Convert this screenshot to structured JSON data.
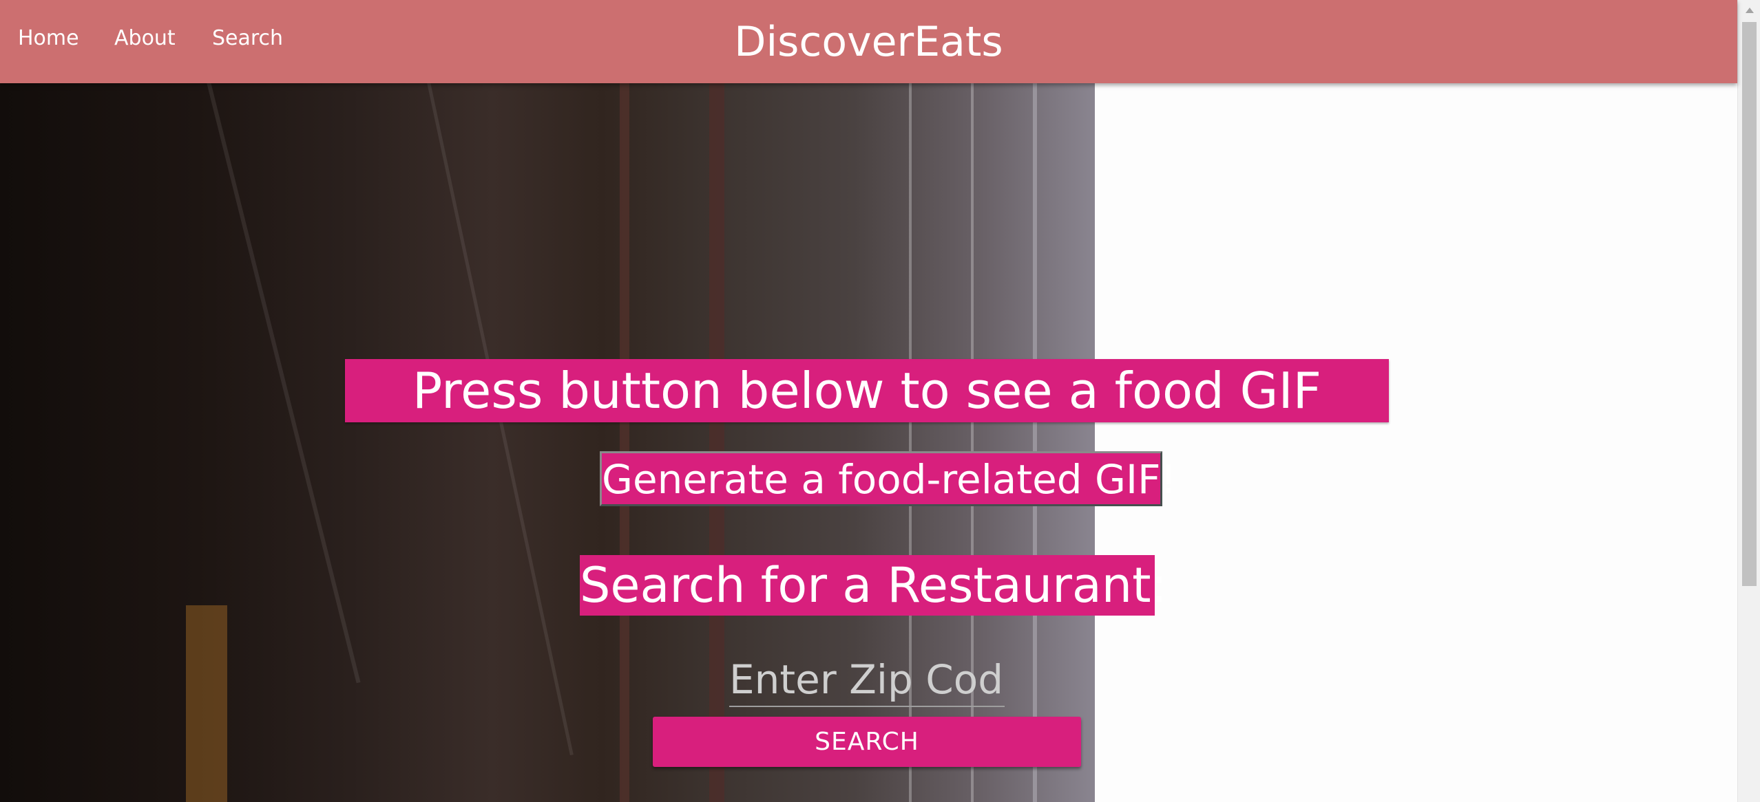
{
  "navbar": {
    "brand": "DiscoverEats",
    "links": [
      "Home",
      "About",
      "Search"
    ],
    "background_color": "#cc6f70"
  },
  "main": {
    "gif_heading": "Press button below to see a food GIF",
    "gif_button_label": "Generate a food-related GIF!",
    "restaurant_heading": "Search for a Restaurant:",
    "zip_placeholder": "Enter Zip Code",
    "zip_value": "",
    "search_button_label": "SEARCH",
    "accent_color": "#d81f7d"
  },
  "scrollbar": {
    "up_arrow_icon": "chevron-up-icon"
  }
}
